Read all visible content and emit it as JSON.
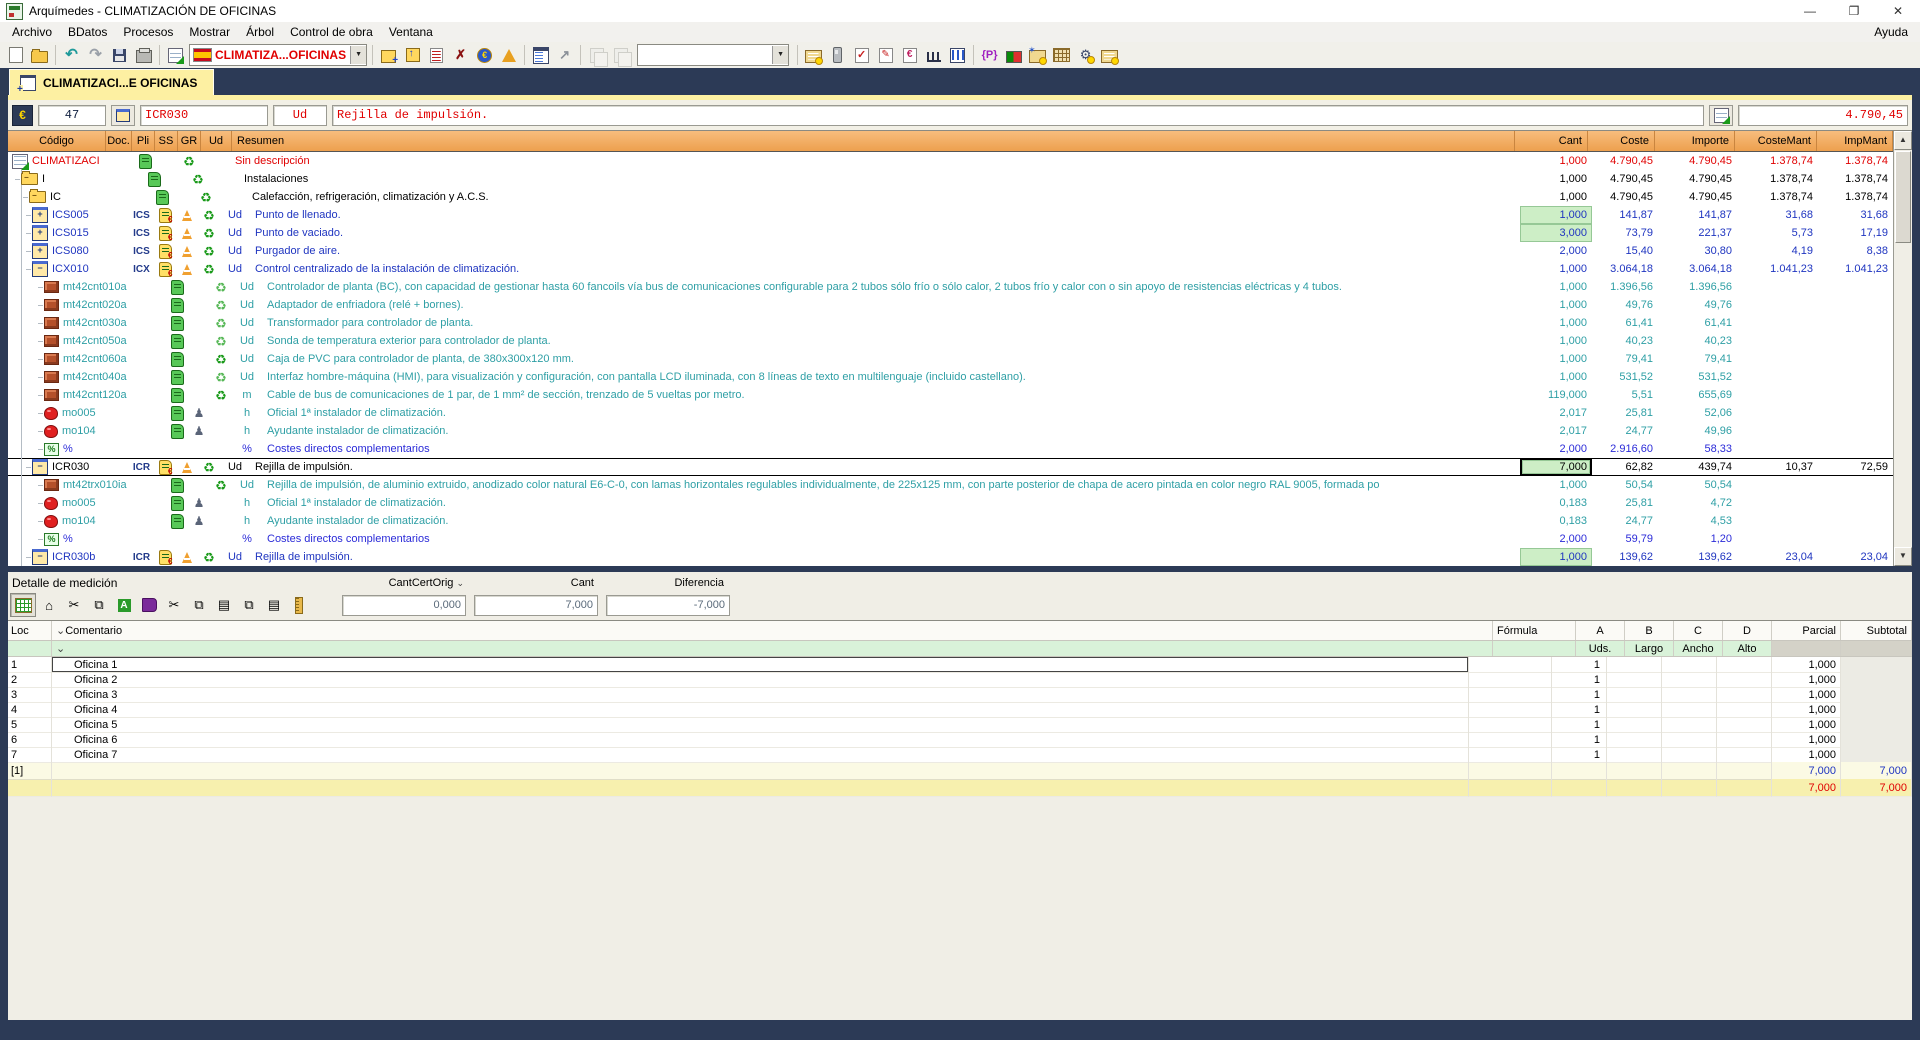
{
  "window": {
    "title": "Arquímedes - CLIMATIZACIÓN DE OFICINAS"
  },
  "menu": {
    "items": [
      "Archivo",
      "BDatos",
      "Procesos",
      "Mostrar",
      "Árbol",
      "Control de obra",
      "Ventana"
    ],
    "help": "Ayuda"
  },
  "toolbar": {
    "job_combo_value": "CLIMATIZA...OFICINAS",
    "search_combo_value": "",
    "groups": [
      {
        "buttons": [
          {
            "name": "new-document-button",
            "g": "g-new"
          },
          {
            "name": "open-file-button",
            "g": "g-open"
          }
        ]
      },
      {
        "buttons": [
          {
            "name": "undo-button",
            "g": "g-undo",
            "t": "↶"
          },
          {
            "name": "redo-button",
            "g": "g-redo",
            "t": "↷"
          },
          {
            "name": "save-button",
            "g": "g-save"
          },
          {
            "name": "print-button",
            "g": "g-print"
          }
        ]
      },
      {
        "buttons": [
          {
            "name": "new-job-button",
            "g": "g-newjob"
          },
          {
            "name": "export-job-button",
            "g": "g-export"
          },
          {
            "name": "report-button",
            "g": "g-report"
          },
          {
            "name": "delete-job-button",
            "g": "g-delete",
            "t": "✗"
          },
          {
            "name": "price-euro-button",
            "g": "g-euro",
            "t": "€"
          },
          {
            "name": "alert-cone-button",
            "g": "g-cone"
          }
        ]
      },
      {
        "buttons": [
          {
            "name": "window-tree-button",
            "g": "g-wintree"
          },
          {
            "name": "chart-button",
            "g": "g-chart",
            "t": "↗"
          }
        ]
      },
      {
        "buttons": [
          {
            "name": "copy-from-button",
            "g": "g-pastebox",
            "dis": true
          },
          {
            "name": "copy-to-button",
            "g": "g-pastebox",
            "dis": true
          }
        ]
      },
      {
        "buttons": [
          {
            "name": "card-search-button",
            "g": "g-card"
          },
          {
            "name": "device-button",
            "g": "g-usb"
          },
          {
            "name": "check-doc-button",
            "g": "g-checkdoc",
            "t": "✓"
          },
          {
            "name": "edit-doc-button",
            "g": "g-editdoc",
            "t": "✎"
          },
          {
            "name": "euro-doc-button",
            "g": "g-eurodoc",
            "t": "€"
          },
          {
            "name": "histogram-button",
            "g": "g-histo"
          },
          {
            "name": "book-columns-button",
            "g": "g-book"
          }
        ]
      },
      {
        "buttons": [
          {
            "name": "braces-button",
            "g": "g-braces",
            "t": "{P}"
          },
          {
            "name": "flag-chart-button",
            "g": "g-flagchart"
          },
          {
            "name": "card-star-button",
            "g": "g-cardstar"
          },
          {
            "name": "table-grid-button",
            "g": "g-grid"
          },
          {
            "name": "gear-button",
            "g": "g-gear",
            "t": "⚙"
          },
          {
            "name": "card-seal-button",
            "g": "g-card"
          }
        ]
      }
    ]
  },
  "tab": {
    "label": "CLIMATIZACI...E OFICINAS"
  },
  "editbar": {
    "row_number": "47",
    "code": "ICR030",
    "unit": "Ud",
    "summary": "Rejilla de impulsión.",
    "amount": "4.790,45"
  },
  "tree": {
    "headers": [
      "Código",
      "Doc.",
      "Pli",
      "SS",
      "GR",
      "Ud",
      "Resumen",
      "Cant",
      "Coste",
      "Importe",
      "CosteMant",
      "ImpMant"
    ],
    "rows": [
      {
        "level": 0,
        "icon": "sheet",
        "code": "CLIMATIZACI",
        "doc": "",
        "pli": "scroll",
        "ss": "",
        "gr": "recycle",
        "ud": "",
        "resumen": "Sin descripción",
        "color": "red",
        "cant": "1,000",
        "coste": "4.790,45",
        "importe": "4.790,45",
        "costemant": "1.378,74",
        "impmant": "1.378,74"
      },
      {
        "level": 1,
        "icon": "folder",
        "code": "I",
        "doc": "",
        "pli": "scroll",
        "ss": "",
        "gr": "recycle",
        "ud": "",
        "resumen": "Instalaciones",
        "color": "black",
        "cant": "1,000",
        "coste": "4.790,45",
        "importe": "4.790,45",
        "costemant": "1.378,74",
        "impmant": "1.378,74"
      },
      {
        "level": 2,
        "icon": "folder",
        "code": "IC",
        "doc": "",
        "pli": "scroll",
        "ss": "",
        "gr": "recycle",
        "ud": "",
        "resumen": "Calefacción, refrigeración, climatización y A.C.S.",
        "color": "black",
        "cant": "1,000",
        "coste": "4.790,45",
        "importe": "4.790,45",
        "costemant": "1.378,74",
        "impmant": "1.378,74"
      },
      {
        "level": 3,
        "icon": "unit",
        "expand": "+",
        "code": "ICS005",
        "doc": "ICS",
        "pli": "euroscroll",
        "ss": "cone",
        "gr": "recycle",
        "ud": "Ud",
        "resumen": "Punto de llenado.",
        "color": "blue",
        "cant": "1,000",
        "hl": true,
        "coste": "141,87",
        "importe": "141,87",
        "costemant": "31,68",
        "impmant": "31,68"
      },
      {
        "level": 3,
        "icon": "unit",
        "expand": "+",
        "code": "ICS015",
        "doc": "ICS",
        "pli": "euroscroll",
        "ss": "cone",
        "gr": "recycle",
        "ud": "Ud",
        "resumen": "Punto de vaciado.",
        "color": "blue",
        "cant": "3,000",
        "hl": true,
        "coste": "73,79",
        "importe": "221,37",
        "costemant": "5,73",
        "impmant": "17,19"
      },
      {
        "level": 3,
        "icon": "unit",
        "expand": "+",
        "code": "ICS080",
        "doc": "ICS",
        "pli": "euroscroll",
        "ss": "cone",
        "gr": "recycle",
        "ud": "Ud",
        "resumen": "Purgador de aire.",
        "color": "blue",
        "cant": "2,000",
        "coste": "15,40",
        "importe": "30,80",
        "costemant": "4,19",
        "impmant": "8,38"
      },
      {
        "level": 3,
        "icon": "unit",
        "expand": "−",
        "code": "ICX010",
        "doc": "ICX",
        "pli": "euroscroll",
        "ss": "cone",
        "gr": "recycle",
        "ud": "Ud",
        "resumen": "Control centralizado de la instalación de climatización.",
        "color": "blue",
        "cant": "1,000",
        "coste": "3.064,18",
        "importe": "3.064,18",
        "costemant": "1.041,23",
        "impmant": "1.041,23"
      },
      {
        "level": 4,
        "icon": "brick",
        "code": "mt42cnt010a",
        "doc": "",
        "pli": "scroll",
        "ss": "",
        "gr": "recycle2",
        "ud": "Ud",
        "resumen": "Controlador de planta (BC), con capacidad de gestionar hasta 60 fancoils vía bus de comunicaciones configurable para 2 tubos sólo frío o sólo calor, 2 tubos frío y calor con o sin apoyo de resistencias eléctricas y 4 tubos.",
        "color": "teal",
        "cant": "1,000",
        "coste": "1.396,56",
        "importe": "1.396,56",
        "costemant": "",
        "impmant": ""
      },
      {
        "level": 4,
        "icon": "brick",
        "code": "mt42cnt020a",
        "doc": "",
        "pli": "scroll",
        "ss": "",
        "gr": "recycle2",
        "ud": "Ud",
        "resumen": "Adaptador de enfriadora (relé + bornes).",
        "color": "teal",
        "cant": "1,000",
        "coste": "49,76",
        "importe": "49,76",
        "costemant": "",
        "impmant": ""
      },
      {
        "level": 4,
        "icon": "brick",
        "code": "mt42cnt030a",
        "doc": "",
        "pli": "scroll",
        "ss": "",
        "gr": "recycle2",
        "ud": "Ud",
        "resumen": "Transformador para controlador de planta.",
        "color": "teal",
        "cant": "1,000",
        "coste": "61,41",
        "importe": "61,41",
        "costemant": "",
        "impmant": ""
      },
      {
        "level": 4,
        "icon": "brick",
        "code": "mt42cnt050a",
        "doc": "",
        "pli": "scroll",
        "ss": "",
        "gr": "recycle2",
        "ud": "Ud",
        "resumen": "Sonda de temperatura exterior para controlador de planta.",
        "color": "teal",
        "cant": "1,000",
        "coste": "40,23",
        "importe": "40,23",
        "costemant": "",
        "impmant": ""
      },
      {
        "level": 4,
        "icon": "brick",
        "code": "mt42cnt060a",
        "doc": "",
        "pli": "scroll",
        "ss": "",
        "gr": "recycle",
        "ud": "Ud",
        "resumen": "Caja de PVC para controlador de planta, de 380x300x120 mm.",
        "color": "teal",
        "cant": "1,000",
        "coste": "79,41",
        "importe": "79,41",
        "costemant": "",
        "impmant": ""
      },
      {
        "level": 4,
        "icon": "brick",
        "code": "mt42cnt040a",
        "doc": "",
        "pli": "scroll",
        "ss": "",
        "gr": "recycle2",
        "ud": "Ud",
        "resumen": "Interfaz hombre-máquina (HMI), para visualización y configuración, con pantalla LCD iluminada, con 8 líneas de texto en multilenguaje (incluido castellano).",
        "color": "teal",
        "cant": "1,000",
        "coste": "531,52",
        "importe": "531,52",
        "costemant": "",
        "impmant": ""
      },
      {
        "level": 4,
        "icon": "brick",
        "code": "mt42cnt120a",
        "doc": "",
        "pli": "scroll",
        "ss": "",
        "gr": "recycle",
        "ud": "m",
        "resumen": "Cable de bus de comunicaciones de 1 par, de 1 mm² de sección, trenzado de 5 vueltas por metro.",
        "color": "teal",
        "cant": "119,000",
        "coste": "5,51",
        "importe": "655,69",
        "costemant": "",
        "impmant": ""
      },
      {
        "level": 4,
        "icon": "labor",
        "code": "mo005",
        "doc": "",
        "pli": "scroll",
        "ss": "person",
        "gr": "",
        "ud": "h",
        "resumen": "Oficial 1ª instalador de climatización.",
        "color": "teal",
        "cant": "2,017",
        "coste": "25,81",
        "importe": "52,06",
        "costemant": "",
        "impmant": ""
      },
      {
        "level": 4,
        "icon": "labor",
        "code": "mo104",
        "doc": "",
        "pli": "scroll",
        "ss": "person",
        "gr": "",
        "ud": "h",
        "resumen": "Ayudante instalador de climatización.",
        "color": "teal",
        "cant": "2,017",
        "coste": "24,77",
        "importe": "49,96",
        "costemant": "",
        "impmant": ""
      },
      {
        "level": 4,
        "icon": "pct",
        "code": "%",
        "doc": "",
        "pli": "",
        "ss": "",
        "gr": "",
        "ud": "%",
        "resumen": "Costes directos complementarios",
        "color": "pct",
        "cant": "2,000",
        "coste": "2.916,60",
        "importe": "58,33",
        "costemant": "",
        "impmant": ""
      },
      {
        "level": 3,
        "icon": "unit",
        "expand": "−",
        "code": "ICR030",
        "doc": "ICR",
        "pli": "euroscroll",
        "ss": "cone",
        "gr": "recycle",
        "ud": "Ud",
        "resumen": "Rejilla de impulsión.",
        "color": "black",
        "selected": true,
        "cant": "7,000",
        "hl": true,
        "selcell": true,
        "coste": "62,82",
        "importe": "439,74",
        "costemant": "10,37",
        "impmant": "72,59"
      },
      {
        "level": 4,
        "icon": "brick",
        "code": "mt42trx010ia",
        "doc": "",
        "pli": "scroll",
        "ss": "",
        "gr": "recycle",
        "ud": "Ud",
        "resumen": "Rejilla de impulsión, de aluminio extruido, anodizado color natural E6-C-0, con lamas horizontales regulables individualmente, de 225x125 mm, con parte posterior de chapa de acero pintada en color negro RAL 9005, formada po",
        "color": "teal",
        "cant": "1,000",
        "coste": "50,54",
        "importe": "50,54",
        "costemant": "",
        "impmant": ""
      },
      {
        "level": 4,
        "icon": "labor",
        "code": "mo005",
        "doc": "",
        "pli": "scroll",
        "ss": "person",
        "gr": "",
        "ud": "h",
        "resumen": "Oficial 1ª instalador de climatización.",
        "color": "teal",
        "cant": "0,183",
        "coste": "25,81",
        "importe": "4,72",
        "costemant": "",
        "impmant": ""
      },
      {
        "level": 4,
        "icon": "labor",
        "code": "mo104",
        "doc": "",
        "pli": "scroll",
        "ss": "person",
        "gr": "",
        "ud": "h",
        "resumen": "Ayudante instalador de climatización.",
        "color": "teal",
        "cant": "0,183",
        "coste": "24,77",
        "importe": "4,53",
        "costemant": "",
        "impmant": ""
      },
      {
        "level": 4,
        "icon": "pct",
        "code": "%",
        "doc": "",
        "pli": "",
        "ss": "",
        "gr": "",
        "ud": "%",
        "resumen": "Costes directos complementarios",
        "color": "pct",
        "cant": "2,000",
        "coste": "59,79",
        "importe": "1,20",
        "costemant": "",
        "impmant": ""
      },
      {
        "level": 3,
        "icon": "unit",
        "expand": "−",
        "code": "ICR030b",
        "doc": "ICR",
        "pli": "euroscroll",
        "ss": "cone",
        "gr": "recycle",
        "ud": "Ud",
        "resumen": "Rejilla de impulsión.",
        "color": "blue",
        "cant": "1,000",
        "hl": true,
        "coste": "139,62",
        "importe": "139,62",
        "costemant": "23,04",
        "impmant": "23,04"
      }
    ]
  },
  "detail": {
    "title": "Detalle de medición",
    "controls": [
      {
        "label": "CantCertOrig",
        "dropdown": true,
        "value": "0,000"
      },
      {
        "label": "Cant",
        "dropdown": false,
        "value": "7,000"
      },
      {
        "label": "Diferencia",
        "dropdown": false,
        "value": "-7,000"
      }
    ],
    "tools": [
      {
        "name": "meas-table-button",
        "g": "dg-table",
        "pressed": true
      },
      {
        "name": "zoom-prev-button",
        "t": "⌂"
      },
      {
        "name": "split-button",
        "t": "✂"
      },
      {
        "name": "copy-cells-button",
        "t": "⧉"
      },
      {
        "name": "dwg-import-button",
        "g": "dg-dwg",
        "t2": "A"
      },
      {
        "name": "book-button",
        "g": "dg-book"
      },
      {
        "name": "cut-button",
        "t": "✂"
      },
      {
        "name": "copy-button",
        "t": "⧉"
      },
      {
        "name": "paste-button",
        "t": "▤"
      },
      {
        "name": "copy-doc-button",
        "t": "⧉"
      },
      {
        "name": "paste-doc-button",
        "t": "▤"
      },
      {
        "name": "ruler-button",
        "g": "dg-ruler"
      }
    ],
    "table": {
      "loc_header": "Loc",
      "comment_header": "Comentario",
      "formula_header": "Fórmula",
      "col_headers": [
        "A",
        "B",
        "C",
        "D"
      ],
      "sub_headers": [
        "Uds.",
        "Largo",
        "Ancho",
        "Alto"
      ],
      "parcial_header": "Parcial",
      "subtotal_header": "Subtotal",
      "rows": [
        {
          "loc": "1",
          "comment": "Oficina 1",
          "uds": "1",
          "parcial": "1,000"
        },
        {
          "loc": "2",
          "comment": "Oficina 2",
          "uds": "1",
          "parcial": "1,000"
        },
        {
          "loc": "3",
          "comment": "Oficina 3",
          "uds": "1",
          "parcial": "1,000"
        },
        {
          "loc": "4",
          "comment": "Oficina 4",
          "uds": "1",
          "parcial": "1,000"
        },
        {
          "loc": "5",
          "comment": "Oficina 5",
          "uds": "1",
          "parcial": "1,000"
        },
        {
          "loc": "6",
          "comment": "Oficina 6",
          "uds": "1",
          "parcial": "1,000"
        },
        {
          "loc": "7",
          "comment": "Oficina 7",
          "uds": "1",
          "parcial": "1,000"
        }
      ],
      "group_row": {
        "loc": "[1]",
        "parcial": "7,000",
        "subtotal": "7,000"
      },
      "total_row": {
        "parcial": "7,000",
        "subtotal": "7,000"
      }
    }
  },
  "colors": {
    "app_background": "#2c3a56",
    "tab_yellow": "#fdf0a2",
    "header_orange": "#eda04e",
    "highlight_green": "#cdeec6",
    "text_red": "#e00000",
    "text_blue": "#1f35c0",
    "text_teal": "#2e9fa5",
    "total_yellow": "#f7f0ae"
  }
}
